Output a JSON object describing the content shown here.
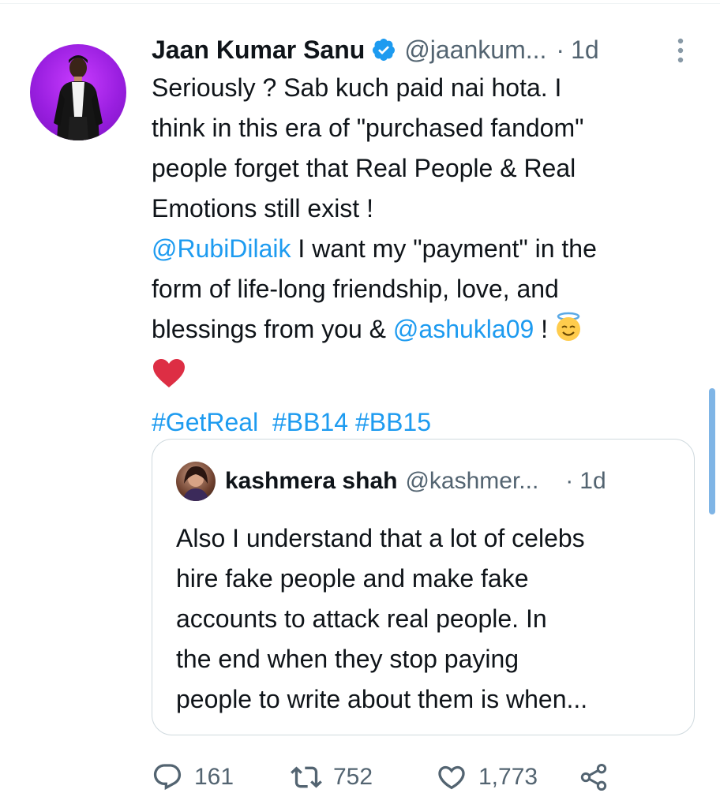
{
  "tweet": {
    "author_name": "Jaan Kumar Sanu",
    "handle": "@jaankum...",
    "separator": "·",
    "time": "1d",
    "text_lines": [
      "Seriously ? Sab kuch paid nai hota. I",
      "think in this era of \"purchased fandom\"",
      "people forget that Real People & Real",
      "Emotions still exist !"
    ],
    "mention1": "@RubiDilaik",
    "line5_rest": " I want my \"payment\" in the",
    "line6": "form of life-long friendship, love, and",
    "line7_start": "blessings from you & ",
    "mention2": "@ashukla09",
    "line7_end": " !",
    "hashtags": [
      "#GetReal",
      "#BB14",
      "#BB15"
    ]
  },
  "quoted": {
    "author_name": "kashmera shah",
    "handle": "@kashmer...",
    "separator": "·",
    "time": "1d",
    "text_lines": [
      "Also I understand that a lot of celebs",
      "hire fake people and make fake",
      "accounts to attack real people. In",
      "the end when they stop paying",
      "people to write about them is when..."
    ]
  },
  "actions": {
    "replies": "161",
    "retweets": "752",
    "likes": "1,773"
  },
  "icons": {
    "verified": "verified-badge-icon",
    "more": "more-options-icon",
    "reply": "reply-icon",
    "retweet": "retweet-icon",
    "like": "heart-icon",
    "share": "share-icon"
  },
  "colors": {
    "link": "#1d9bf0",
    "secondary_text": "#536471",
    "avatar_bg": "#9a1fe0"
  }
}
